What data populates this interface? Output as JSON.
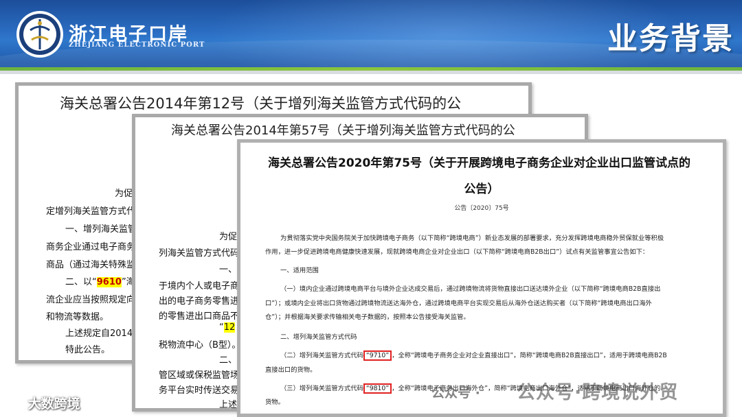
{
  "header": {
    "brand_cn": "浙江电子口岸",
    "brand_en": "ZHEJIANG ELECTRONIC PORT",
    "title": "业务背景"
  },
  "doc1": {
    "title": "海关总署公告2014年第12号（关于增列海关监管方式代码的公",
    "lines": {
      "l1": "为促",
      "l2": "定增列海关监管方式代",
      "l3": "一、增列海关监管",
      "l4": "商务企业通过电子商务",
      "l5": "商品（通过海关特殊监",
      "l6_pre": "二、以“",
      "l6_code": "9610",
      "l6_post": "”海",
      "l7": "流企业应当按照规定向",
      "l8": "和物流等数据。",
      "l9": "上述规定自2014年",
      "l10": "特此公告。"
    }
  },
  "doc2": {
    "title": "海关总署公告2014年第57号（关于增列海关监管方式代码的公",
    "lines": {
      "l1": "为促",
      "l2": "列海关监管方式代码，",
      "l3": "一、",
      "l4": "于境内个人或电子商务",
      "l5": "出的电子商务零售进口",
      "l6": "的零售进出口商品不适",
      "l7_code": "12",
      "l8": "税物流中心（B型）。",
      "l9": "二、",
      "l10": "管区域或保税监管场所",
      "l11": "务平台实时传送交易、",
      "l12": "上述"
    }
  },
  "doc3": {
    "title_line1": "海关总署公告2020年第75号（关于开展跨境电子商务企业对企业出口监管试点的",
    "title_line2": "公告）",
    "number": "公告〔2020〕75号",
    "p1": "为贯彻落实党中央国务院关于加快跨境电子商务（以下简称“跨境电商”）新业态发展的部署要求，充分发挥跨境电商稳外贸保就业等积极",
    "p1b": "作用，进一步促进跨境电商健康快速发展，现就跨境电商企业对企业出口（以下简称“跨境电商B2B出口”）试点有关监管事宜公告如下：",
    "s1": "一、适用范围",
    "p2": "（一）境内企业通过跨境电商平台与境外企业达成交易后，通过跨境物流将货物直接出口送达境外企业（以下简称“跨境电商B2B直接出",
    "p2b": "口”）；或境内企业将出口货物通过跨境物流送达海外仓，通过跨境电商平台实现交易后从海外仓送达购买者（以下简称“跨境电商出口海外",
    "p2c": "仓”）；并根据海关要求传输相关电子数据的，按照本公告接受海关监管。",
    "s2": "二、增列海关监管方式代码",
    "p3_pre": "（二）增列海关监管方式代码",
    "p3_code": "“9710”",
    "p3_post": "，全称“跨境电子商务企业对企业直接出口”，简称“跨境电商B2B直接出口”，适用于跨境电商B2B",
    "p3b": "直接出口的货物。",
    "p4_pre": "（三）增列海关监管方式代码",
    "p4_code": "“9810”",
    "p4_post": "，全称“跨境电子商务出口海外仓”，简称“跨境电商出口海外仓”，适用于跨境电商出口海外仓的",
    "p4b": "货物。"
  },
  "footer": {
    "logo_text": "大数跨境",
    "wm1": "公众号 ·",
    "wm2": "公众号·跨境说外贸"
  }
}
